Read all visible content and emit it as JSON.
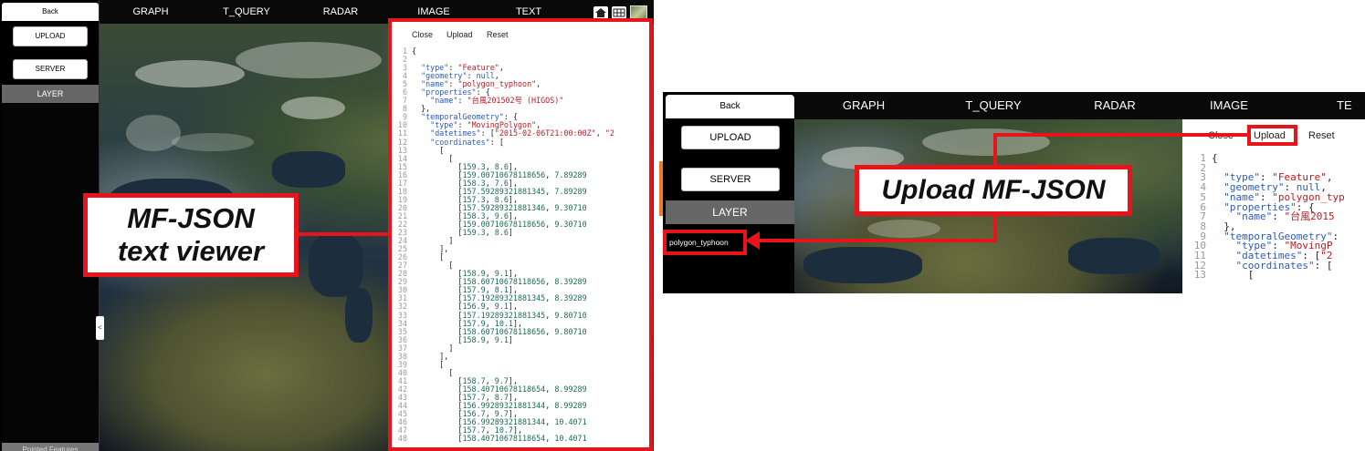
{
  "left": {
    "side": {
      "back": "Back",
      "upload": "UPLOAD",
      "server": "SERVER",
      "layer": "LAYER",
      "bottom": "Pointed Features"
    },
    "tabs": [
      "GRAPH",
      "T_QUERY",
      "RADAR",
      "IMAGE",
      "TEXT"
    ],
    "panel": {
      "close": "Close",
      "upload": "Upload",
      "reset": "Reset"
    },
    "collapse": "<",
    "callout": {
      "line1": "MF-JSON",
      "line2": "text viewer"
    }
  },
  "right": {
    "side": {
      "back": "Back",
      "upload": "UPLOAD",
      "server": "SERVER",
      "layer": "LAYER",
      "layer_item": "polygon_typhoon"
    },
    "tabs": [
      "GRAPH",
      "T_QUERY",
      "RADAR",
      "IMAGE",
      "TE"
    ],
    "panel": {
      "close": "Close",
      "upload": "Upload",
      "reset": "Reset"
    },
    "callout": "Upload MF-JSON"
  },
  "json_lines": [
    "{",
    "",
    "  \"type\": \"Feature\",",
    "  \"geometry\": null,",
    "  \"name\": \"polygon_typhoon\",",
    "  \"properties\": {",
    "    \"name\": \"台風201502号 (HIGOS)\"",
    "  },",
    "  \"temporalGeometry\": {",
    "    \"type\": \"MovingPolygon\",",
    "    \"datetimes\": [\"2015-02-06T21:00:00Z\", \"2",
    "    \"coordinates\": [",
    "      [",
    "        [",
    "          [159.3, 8.6],",
    "          [159.00710678118656, 7.89289",
    "          [158.3, 7.6],",
    "          [157.59289321881345, 7.89289",
    "          [157.3, 8.6],",
    "          [157.59289321881346, 9.30710",
    "          [158.3, 9.6],",
    "          [159.00710678118656, 9.30710",
    "          [159.3, 8.6]",
    "        ]",
    "      ],",
    "      [",
    "        [",
    "          [158.9, 9.1],",
    "          [158.60710678118656, 8.39289",
    "          [157.9, 8.1],",
    "          [157.19289321881345, 8.39289",
    "          [156.9, 9.1],",
    "          [157.19289321881345, 9.80710",
    "          [157.9, 10.1],",
    "          [158.60710678118656, 9.80710",
    "          [158.9, 9.1]",
    "        ]",
    "      ],",
    "      [",
    "        [",
    "          [158.7, 9.7],",
    "          [158.40710678118654, 8.99289",
    "          [157.7, 8.7],",
    "          [156.99289321881344, 8.99289",
    "          [156.7, 9.7],",
    "          [156.99289321881344, 10.4071",
    "          [157.7, 10.7],",
    "          [158.40710678118654, 10.4071"
  ],
  "json_lines_right": [
    "{",
    "",
    "  \"type\": \"Feature\",",
    "  \"geometry\": null,",
    "  \"name\": \"polygon_typ",
    "  \"properties\": {",
    "    \"name\": \"台風2015",
    "  },",
    "  \"temporalGeometry\":",
    "    \"type\": \"MovingP",
    "    \"datetimes\": [\"2",
    "    \"coordinates\": [",
    "      ["
  ],
  "colors": {
    "accent": "#e8141c",
    "arrow": "#f07a2a",
    "key": "#2b59c3",
    "string": "#c2191f",
    "number": "#1a6b54"
  }
}
